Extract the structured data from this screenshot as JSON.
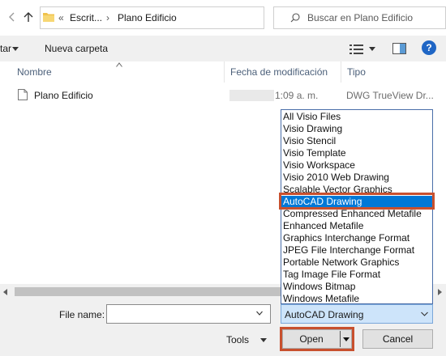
{
  "address_bar": {
    "overflow": "«",
    "segments": [
      "Escrit...",
      "Plano Edificio"
    ],
    "separator": "›",
    "search_placeholder": "Buscar en Plano Edificio"
  },
  "command_bar": {
    "organize_label": "tar",
    "new_folder_label": "Nueva carpeta"
  },
  "file_list": {
    "columns": [
      "Nombre",
      "Fecha de modificación",
      "Tipo"
    ],
    "rows": [
      {
        "name": "Plano Edificio",
        "date": "1:09 a. m.",
        "type": "DWG TrueView Dr..."
      }
    ]
  },
  "file_type_dropdown": {
    "options": [
      "All Visio Files",
      "Visio Drawing",
      "Visio Stencil",
      "Visio Template",
      "Visio Workspace",
      "Visio 2010 Web Drawing",
      "Scalable Vector Graphics",
      "AutoCAD Drawing",
      "Compressed Enhanced Metafile",
      "Enhanced Metafile",
      "Graphics Interchange Format",
      "JPEG File Interchange Format",
      "Portable Network Graphics",
      "Tag Image File Format",
      "Windows Bitmap",
      "Windows Metafile"
    ],
    "selected_index": 7,
    "selected_value": "AutoCAD Drawing"
  },
  "bottom": {
    "file_name_label": "File name:",
    "file_name_value": "",
    "tools_label": "Tools",
    "open_label": "Open",
    "cancel_label": "Cancel"
  },
  "colors": {
    "accent": "#0078d7",
    "highlight": "#c8502e",
    "help": "#1f66c5",
    "folder": "#f0c24c"
  }
}
